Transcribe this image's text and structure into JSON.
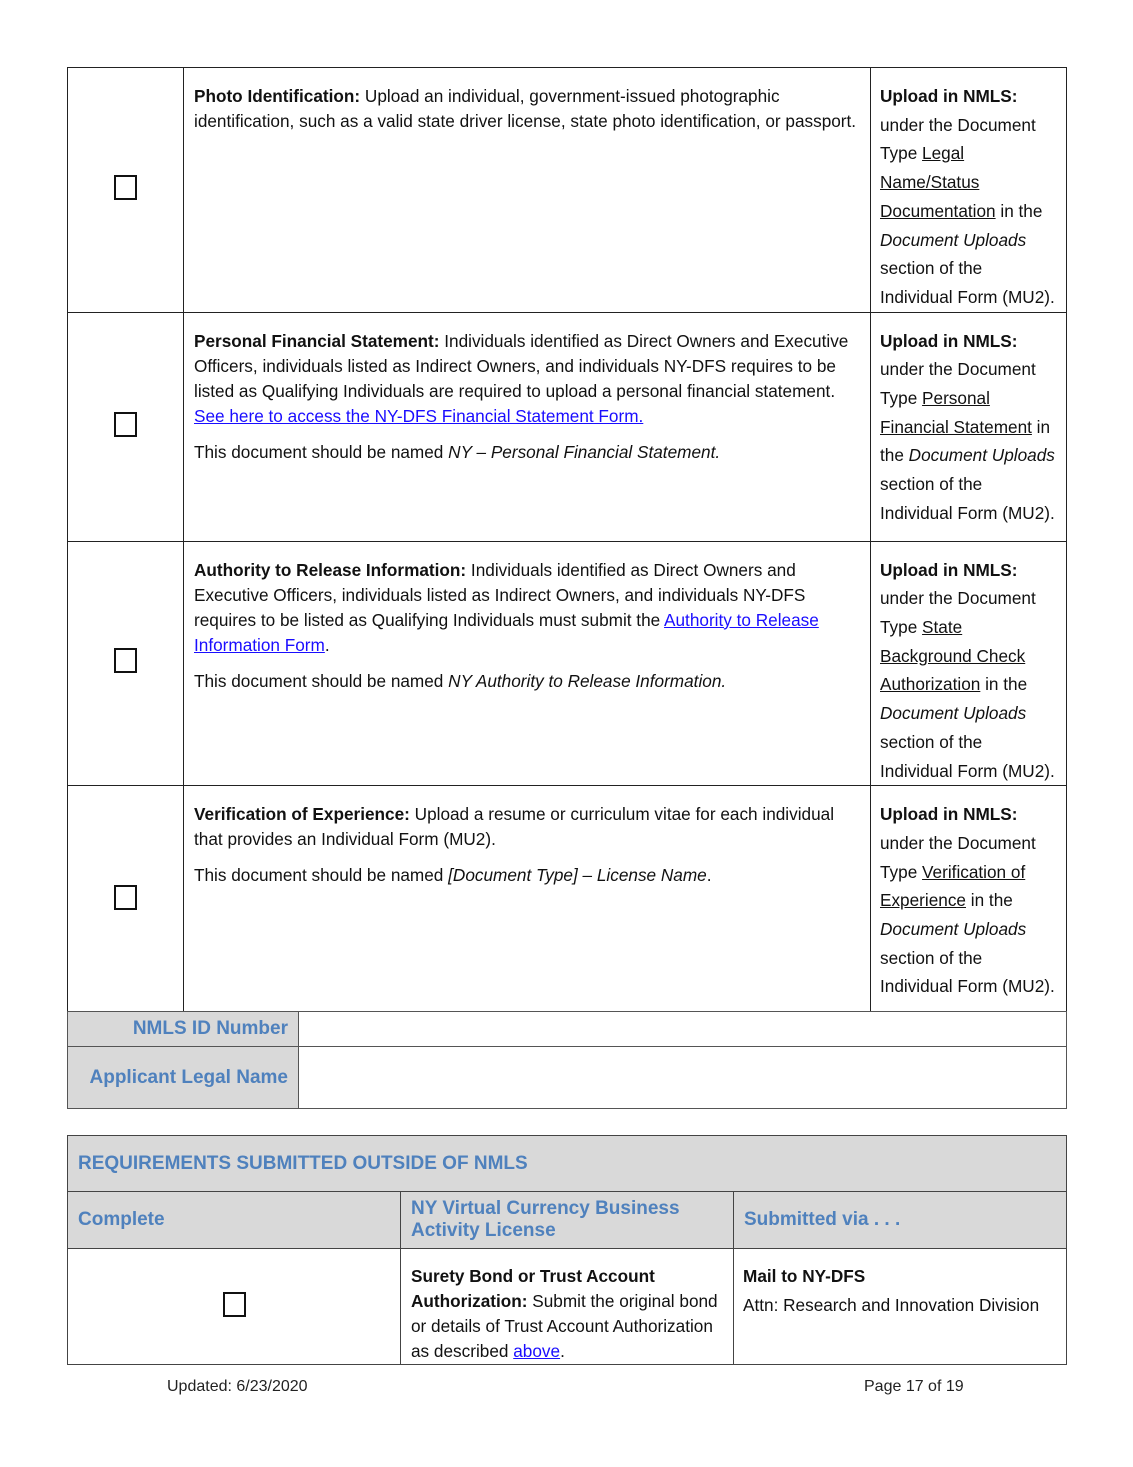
{
  "document_rows": [
    {
      "title": "Photo Identification:",
      "desc_parts": {
        "a": " Upload an individual, government-issued photographic identification, such as a valid state driver license, state photo identification, or passport."
      },
      "upload": {
        "lead": "Upload in NMLS:",
        "pre": " under the Document Type ",
        "doc_type": "Legal Name/Status Documentation",
        "mid": " in the ",
        "section": "Document Uploads",
        "post": " section of the Individual Form (MU2)."
      }
    },
    {
      "title": "Personal Financial Statement:",
      "desc_parts": {
        "a": " Individuals identified as Direct Owners and Executive Officers, individuals listed as Indirect Owners, and individuals NY-DFS requires to be listed as Qualifying Individuals are required to upload a personal financial statement.  ",
        "link": "See here to access the NY-DFS Financial Statement Form.",
        "b": ""
      },
      "naming": {
        "pre": "This document should be named ",
        "name": "NY – Personal Financial Statement."
      },
      "upload": {
        "lead": "Upload in NMLS:",
        "pre": " under the Document Type ",
        "doc_type": "Personal Financial Statement",
        "mid": " in the ",
        "section": "Document Uploads",
        "post": " section of the Individual Form (MU2)."
      }
    },
    {
      "title": "Authority to Release Information:",
      "desc_parts": {
        "a": " Individuals identified as Direct Owners and Executive Officers, individuals listed as Indirect Owners, and individuals NY-DFS requires to be listed as Qualifying Individuals must submit the ",
        "link": "Authority to Release Information Form",
        "b": "."
      },
      "naming": {
        "pre": "This document should be named ",
        "name": "NY Authority to Release Information."
      },
      "upload": {
        "lead": "Upload in NMLS:",
        "pre": " under the Document Type ",
        "doc_type": "State Background Check Authorization",
        "mid": " in the ",
        "section": "Document Uploads",
        "post": " section of the Individual Form (MU2)."
      }
    },
    {
      "title": "Verification of Experience:",
      "desc_parts": {
        "a": " Upload a resume or curriculum vitae for each individual that provides an Individual Form (MU2)."
      },
      "naming": {
        "pre": "This document should be named ",
        "name": "[Document Type] – License Name",
        "post": "."
      },
      "upload": {
        "lead": "Upload in NMLS:",
        "pre": " under the Document Type ",
        "doc_type": "Verification of Experience",
        "mid": " in the ",
        "section": "Document Uploads",
        "post": " section of the Individual Form (MU2)."
      }
    }
  ],
  "applicant": {
    "nmls_id_label": "NMLS ID Number",
    "nmls_id_value": "",
    "legal_name_label": "Applicant Legal Name",
    "legal_name_value": ""
  },
  "outside_nmls": {
    "section_title": "REQUIREMENTS SUBMITTED OUTSIDE OF NMLS",
    "col_complete": "Complete",
    "col_license": "NY Virtual Currency Business Activity License",
    "col_submitted": "Submitted via . . .",
    "rows": [
      {
        "title": "Surety Bond or Trust Account Authorization:",
        "a": " Submit the original bond or details of Trust Account Authorization as described ",
        "link": "above",
        "b": ".",
        "via_title": "Mail to NY-DFS",
        "via_detail": "Attn: Research and Innovation Division"
      }
    ]
  },
  "footer": {
    "updated": "Updated: 6/23/2020",
    "page": "Page 17 of 19"
  },
  "colors": {
    "header_text": "#4f81bd",
    "header_bg": "#d9d9d9",
    "link": "#1a0dff"
  }
}
